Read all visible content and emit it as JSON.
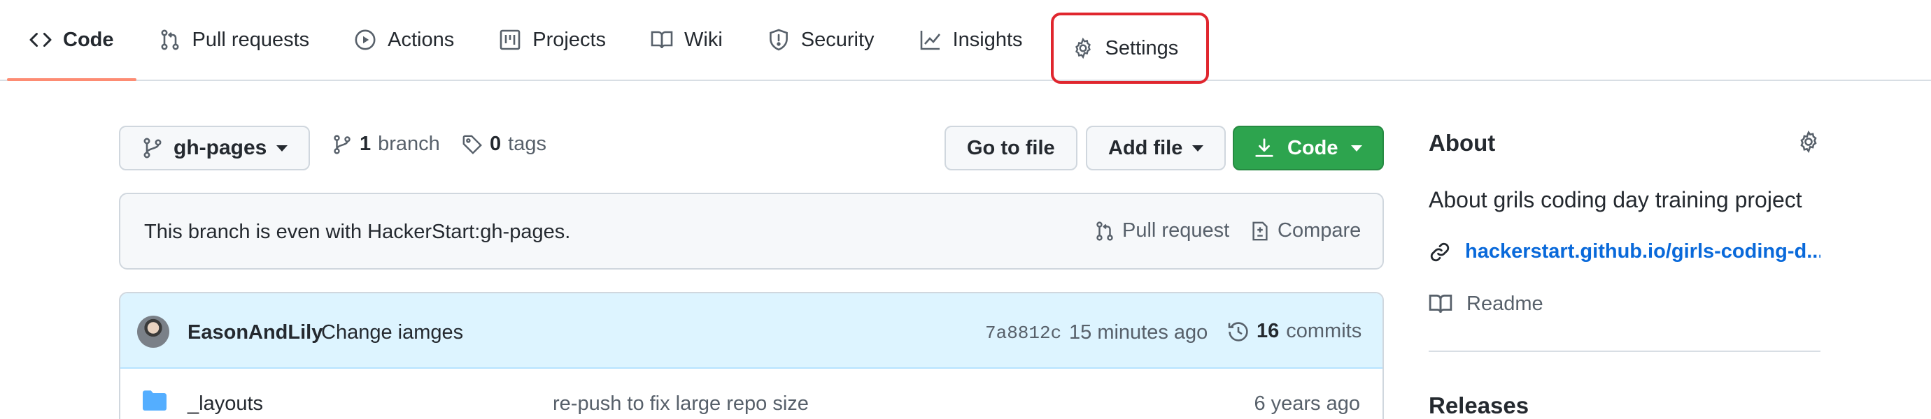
{
  "tabs": [
    {
      "label": "Code",
      "icon": "code-icon",
      "active": true
    },
    {
      "label": "Pull requests",
      "icon": "git-pull-request-icon"
    },
    {
      "label": "Actions",
      "icon": "play-icon"
    },
    {
      "label": "Projects",
      "icon": "project-icon"
    },
    {
      "label": "Wiki",
      "icon": "book-icon"
    },
    {
      "label": "Security",
      "icon": "shield-icon"
    },
    {
      "label": "Insights",
      "icon": "graph-icon"
    },
    {
      "label": "Settings",
      "icon": "gear-icon",
      "highlighted": true
    }
  ],
  "branch": {
    "current": "gh-pages",
    "branch_count": "1",
    "branch_word": "branch",
    "tag_count": "0",
    "tag_word": "tags"
  },
  "actions": {
    "go_to_file": "Go to file",
    "add_file": "Add file",
    "code": "Code"
  },
  "info": {
    "message": "This branch is even with HackerStart:gh-pages.",
    "pull_request": "Pull request",
    "compare": "Compare"
  },
  "commit": {
    "author": "EasonAndLily",
    "message": "Change iamges",
    "sha": "7a8812c",
    "time": "15 minutes ago",
    "count": "16",
    "count_word": "commits"
  },
  "files": [
    {
      "name": "_layouts",
      "commit": "re-push to fix large repo size",
      "age": "6 years ago"
    }
  ],
  "about": {
    "title": "About",
    "description": "About grils coding day training project",
    "link": "hackerstart.github.io/girls-coding-d...",
    "readme": "Readme",
    "releases": "Releases"
  },
  "colors": {
    "accent_green": "#2da44e",
    "link_blue": "#0969da",
    "active_tab_underline": "#fd8c73",
    "highlight_box": "#e0262e",
    "commit_row_bg": "#ddf4ff"
  }
}
